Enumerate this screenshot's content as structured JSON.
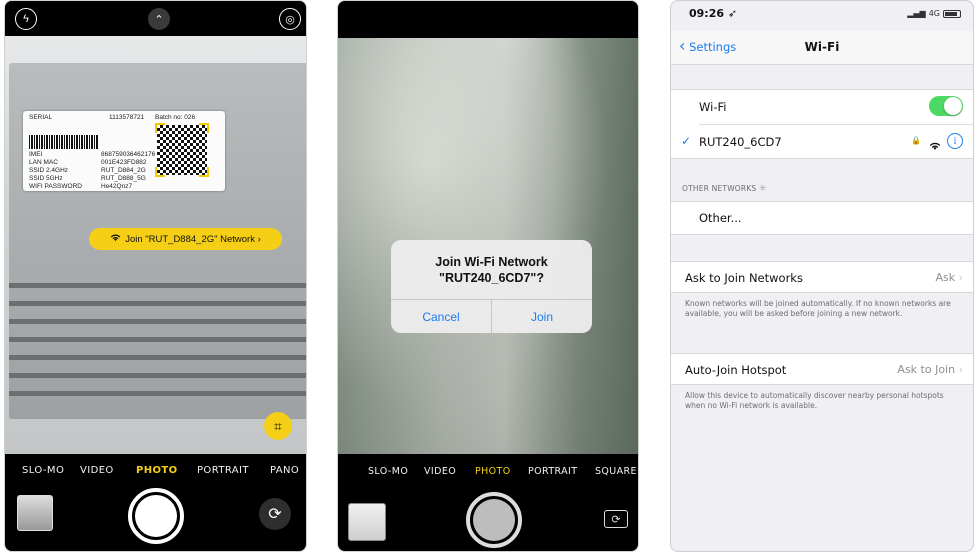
{
  "camera_qr": {
    "modes": [
      "SLO-MO",
      "VIDEO",
      "PHOTO",
      "PORTRAIT",
      "PANO"
    ],
    "active_mode": "PHOTO",
    "label": {
      "serial_key": "SERIAL",
      "serial_val": "1113578721",
      "batch": "Batch no: 026",
      "imei_key": "IMEI",
      "imei_val": "868759036462176",
      "lanmac_key": "LAN MAC",
      "lanmac_val": "001E423FD882",
      "ssid24_key": "SSID 2.4GHz",
      "ssid24_val": "RUT_D884_2G",
      "ssid5_key": "SSID 5GHz",
      "ssid5_val": "RUT_D888_5G",
      "wifipw_key": "WIFI PASSWORD",
      "wifipw_val": "He42Qnz7"
    },
    "join_pill": "Join \"RUT_D884_2G\" Network ›"
  },
  "camera_alert": {
    "modes": [
      "SLO-MO",
      "VIDEO",
      "PHOTO",
      "PORTRAIT",
      "SQUARE"
    ],
    "active_mode": "PHOTO",
    "alert": {
      "title_line1": "Join Wi-Fi Network",
      "title_line2": "\"RUT240_6CD7\"?",
      "cancel": "Cancel",
      "join": "Join"
    }
  },
  "settings": {
    "time": "09:26",
    "network": "4G",
    "back_label": "Settings",
    "title": "Wi-Fi",
    "wifi_label": "Wi-Fi",
    "wifi_on": true,
    "connected_network": "RUT240_6CD7",
    "other_networks_header": "OTHER NETWORKS",
    "other_label": "Other...",
    "ask_join_label": "Ask to Join Networks",
    "ask_join_value": "Ask",
    "ask_join_footer": "Known networks will be joined automatically. If no known networks are available, you will be asked before joining a new network.",
    "autojoin_label": "Auto-Join Hotspot",
    "autojoin_value": "Ask to Join",
    "autojoin_footer": "Allow this device to automatically discover nearby personal hotspots when no Wi-Fi network is available.",
    "accent": "#1a7cf0",
    "toggle_color": "#4cd964"
  }
}
